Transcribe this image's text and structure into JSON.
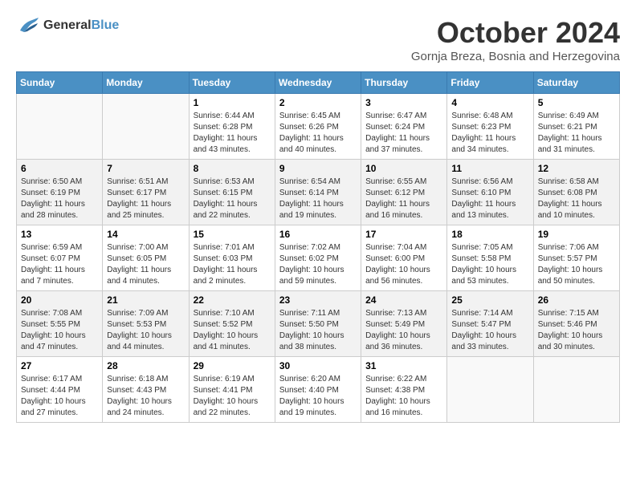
{
  "header": {
    "logo_line1": "General",
    "logo_line2": "Blue",
    "month": "October 2024",
    "location": "Gornja Breza, Bosnia and Herzegovina"
  },
  "weekdays": [
    "Sunday",
    "Monday",
    "Tuesday",
    "Wednesday",
    "Thursday",
    "Friday",
    "Saturday"
  ],
  "weeks": [
    [
      {
        "day": "",
        "info": ""
      },
      {
        "day": "",
        "info": ""
      },
      {
        "day": "1",
        "info": "Sunrise: 6:44 AM\nSunset: 6:28 PM\nDaylight: 11 hours and 43 minutes."
      },
      {
        "day": "2",
        "info": "Sunrise: 6:45 AM\nSunset: 6:26 PM\nDaylight: 11 hours and 40 minutes."
      },
      {
        "day": "3",
        "info": "Sunrise: 6:47 AM\nSunset: 6:24 PM\nDaylight: 11 hours and 37 minutes."
      },
      {
        "day": "4",
        "info": "Sunrise: 6:48 AM\nSunset: 6:23 PM\nDaylight: 11 hours and 34 minutes."
      },
      {
        "day": "5",
        "info": "Sunrise: 6:49 AM\nSunset: 6:21 PM\nDaylight: 11 hours and 31 minutes."
      }
    ],
    [
      {
        "day": "6",
        "info": "Sunrise: 6:50 AM\nSunset: 6:19 PM\nDaylight: 11 hours and 28 minutes."
      },
      {
        "day": "7",
        "info": "Sunrise: 6:51 AM\nSunset: 6:17 PM\nDaylight: 11 hours and 25 minutes."
      },
      {
        "day": "8",
        "info": "Sunrise: 6:53 AM\nSunset: 6:15 PM\nDaylight: 11 hours and 22 minutes."
      },
      {
        "day": "9",
        "info": "Sunrise: 6:54 AM\nSunset: 6:14 PM\nDaylight: 11 hours and 19 minutes."
      },
      {
        "day": "10",
        "info": "Sunrise: 6:55 AM\nSunset: 6:12 PM\nDaylight: 11 hours and 16 minutes."
      },
      {
        "day": "11",
        "info": "Sunrise: 6:56 AM\nSunset: 6:10 PM\nDaylight: 11 hours and 13 minutes."
      },
      {
        "day": "12",
        "info": "Sunrise: 6:58 AM\nSunset: 6:08 PM\nDaylight: 11 hours and 10 minutes."
      }
    ],
    [
      {
        "day": "13",
        "info": "Sunrise: 6:59 AM\nSunset: 6:07 PM\nDaylight: 11 hours and 7 minutes."
      },
      {
        "day": "14",
        "info": "Sunrise: 7:00 AM\nSunset: 6:05 PM\nDaylight: 11 hours and 4 minutes."
      },
      {
        "day": "15",
        "info": "Sunrise: 7:01 AM\nSunset: 6:03 PM\nDaylight: 11 hours and 2 minutes."
      },
      {
        "day": "16",
        "info": "Sunrise: 7:02 AM\nSunset: 6:02 PM\nDaylight: 10 hours and 59 minutes."
      },
      {
        "day": "17",
        "info": "Sunrise: 7:04 AM\nSunset: 6:00 PM\nDaylight: 10 hours and 56 minutes."
      },
      {
        "day": "18",
        "info": "Sunrise: 7:05 AM\nSunset: 5:58 PM\nDaylight: 10 hours and 53 minutes."
      },
      {
        "day": "19",
        "info": "Sunrise: 7:06 AM\nSunset: 5:57 PM\nDaylight: 10 hours and 50 minutes."
      }
    ],
    [
      {
        "day": "20",
        "info": "Sunrise: 7:08 AM\nSunset: 5:55 PM\nDaylight: 10 hours and 47 minutes."
      },
      {
        "day": "21",
        "info": "Sunrise: 7:09 AM\nSunset: 5:53 PM\nDaylight: 10 hours and 44 minutes."
      },
      {
        "day": "22",
        "info": "Sunrise: 7:10 AM\nSunset: 5:52 PM\nDaylight: 10 hours and 41 minutes."
      },
      {
        "day": "23",
        "info": "Sunrise: 7:11 AM\nSunset: 5:50 PM\nDaylight: 10 hours and 38 minutes."
      },
      {
        "day": "24",
        "info": "Sunrise: 7:13 AM\nSunset: 5:49 PM\nDaylight: 10 hours and 36 minutes."
      },
      {
        "day": "25",
        "info": "Sunrise: 7:14 AM\nSunset: 5:47 PM\nDaylight: 10 hours and 33 minutes."
      },
      {
        "day": "26",
        "info": "Sunrise: 7:15 AM\nSunset: 5:46 PM\nDaylight: 10 hours and 30 minutes."
      }
    ],
    [
      {
        "day": "27",
        "info": "Sunrise: 6:17 AM\nSunset: 4:44 PM\nDaylight: 10 hours and 27 minutes."
      },
      {
        "day": "28",
        "info": "Sunrise: 6:18 AM\nSunset: 4:43 PM\nDaylight: 10 hours and 24 minutes."
      },
      {
        "day": "29",
        "info": "Sunrise: 6:19 AM\nSunset: 4:41 PM\nDaylight: 10 hours and 22 minutes."
      },
      {
        "day": "30",
        "info": "Sunrise: 6:20 AM\nSunset: 4:40 PM\nDaylight: 10 hours and 19 minutes."
      },
      {
        "day": "31",
        "info": "Sunrise: 6:22 AM\nSunset: 4:38 PM\nDaylight: 10 hours and 16 minutes."
      },
      {
        "day": "",
        "info": ""
      },
      {
        "day": "",
        "info": ""
      }
    ]
  ]
}
